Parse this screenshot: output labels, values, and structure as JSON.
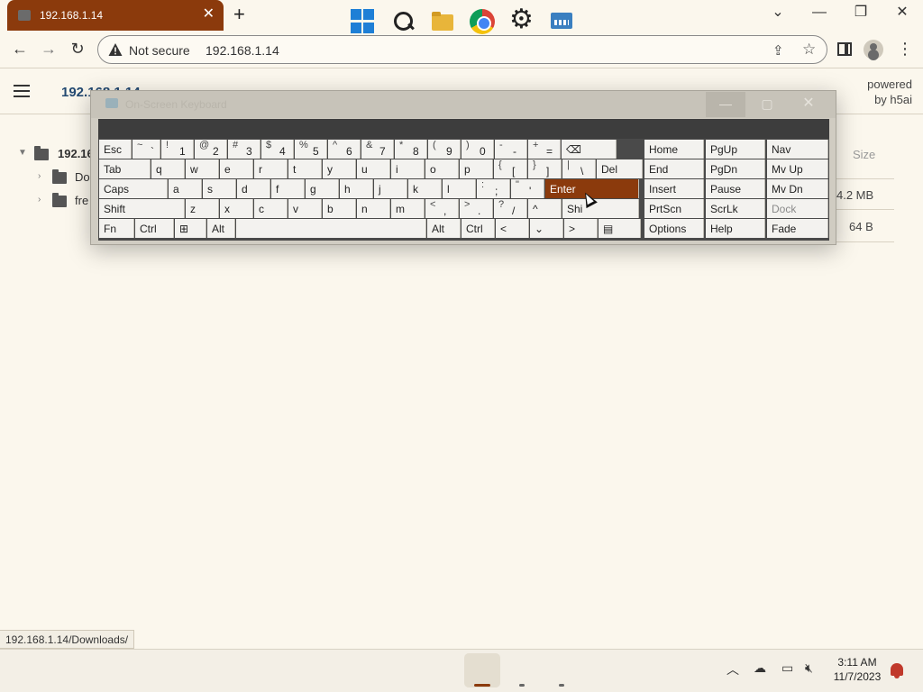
{
  "browser": {
    "tab_title": "192.168.1.14",
    "address": "192.168.1.14",
    "security_label": "Not secure",
    "status_url": "192.168.1.14/Downloads/"
  },
  "page": {
    "title": "192.168.1.14",
    "powered_line1": "powered",
    "powered_line2": "by h5ai",
    "tree_root": "192.16",
    "tree_items": [
      "Do",
      "fre"
    ],
    "size_header": "Size",
    "sizes": [
      "4.2 MB",
      "64 B"
    ]
  },
  "keyboard": {
    "title": "On-Screen Keyboard",
    "rows": [
      [
        {
          "l": "Esc",
          "w": 37
        },
        {
          "s": "~",
          "p": "`",
          "w": 32
        },
        {
          "s": "!",
          "p": "1",
          "w": 37
        },
        {
          "s": "@",
          "p": "2",
          "w": 37
        },
        {
          "s": "#",
          "p": "3",
          "w": 37
        },
        {
          "s": "$",
          "p": "4",
          "w": 37
        },
        {
          "s": "%",
          "p": "5",
          "w": 37
        },
        {
          "s": "^",
          "p": "6",
          "w": 37
        },
        {
          "s": "&",
          "p": "7",
          "w": 37
        },
        {
          "s": "*",
          "p": "8",
          "w": 37
        },
        {
          "s": "(",
          "p": "9",
          "w": 37
        },
        {
          "s": ")",
          "p": "0",
          "w": 37
        },
        {
          "s": "-",
          "p": "-",
          "w": 37
        },
        {
          "s": "+",
          "p": "=",
          "w": 37
        },
        {
          "l": "⌫",
          "w": 62
        }
      ],
      [
        {
          "l": "Tab",
          "w": 58
        },
        {
          "l": "q",
          "w": 38
        },
        {
          "l": "w",
          "w": 38
        },
        {
          "l": "e",
          "w": 38
        },
        {
          "l": "r",
          "w": 38
        },
        {
          "l": "t",
          "w": 38
        },
        {
          "l": "y",
          "w": 38
        },
        {
          "l": "u",
          "w": 38
        },
        {
          "l": "i",
          "w": 38
        },
        {
          "l": "o",
          "w": 38
        },
        {
          "l": "p",
          "w": 38
        },
        {
          "s": "{",
          "p": "[",
          "w": 38
        },
        {
          "s": "}",
          "p": "]",
          "w": 38
        },
        {
          "s": "|",
          "p": "\\",
          "w": 38
        },
        {
          "l": "Del",
          "w": 52
        }
      ],
      [
        {
          "l": "Caps",
          "w": 77
        },
        {
          "l": "a",
          "w": 38
        },
        {
          "l": "s",
          "w": 38
        },
        {
          "l": "d",
          "w": 38
        },
        {
          "l": "f",
          "w": 38
        },
        {
          "l": "g",
          "w": 38
        },
        {
          "l": "h",
          "w": 38
        },
        {
          "l": "j",
          "w": 38
        },
        {
          "l": "k",
          "w": 38
        },
        {
          "l": "l",
          "w": 38
        },
        {
          "s": ":",
          "p": ";",
          "w": 38
        },
        {
          "s": "\"",
          "p": "'",
          "w": 38
        },
        {
          "l": "Enter",
          "w": 105,
          "hl": true
        }
      ],
      [
        {
          "l": "Shift",
          "w": 96
        },
        {
          "l": "z",
          "w": 38
        },
        {
          "l": "x",
          "w": 38
        },
        {
          "l": "c",
          "w": 38
        },
        {
          "l": "v",
          "w": 38
        },
        {
          "l": "b",
          "w": 38
        },
        {
          "l": "n",
          "w": 38
        },
        {
          "l": "m",
          "w": 38
        },
        {
          "s": "<",
          "p": ",",
          "w": 38
        },
        {
          "s": ">",
          "p": ".",
          "w": 38
        },
        {
          "s": "?",
          "p": "/",
          "w": 38
        },
        {
          "l": "^",
          "w": 38
        },
        {
          "l": "Shi",
          "w": 86
        }
      ],
      [
        {
          "l": "Fn",
          "w": 40
        },
        {
          "l": "Ctrl",
          "w": 44
        },
        {
          "l": "⊞",
          "w": 36
        },
        {
          "l": "Alt",
          "w": 32
        },
        {
          "l": "",
          "w": 212
        },
        {
          "l": "Alt",
          "w": 38
        },
        {
          "l": "Ctrl",
          "w": 38
        },
        {
          "l": "<",
          "w": 38
        },
        {
          "l": "⌄",
          "w": 38
        },
        {
          "l": ">",
          "w": 38
        },
        {
          "l": "▤",
          "w": 48
        }
      ]
    ],
    "nav_cols": [
      [
        "Home",
        "End",
        "Insert",
        "PrtScn",
        "Options"
      ],
      [
        "PgUp",
        "PgDn",
        "Pause",
        "ScrLk",
        "Help"
      ],
      [
        "Nav",
        "Mv Up",
        "Mv Dn",
        "Dock",
        "Fade"
      ]
    ]
  },
  "taskbar": {
    "time": "3:11 AM",
    "date": "11/7/2023"
  }
}
